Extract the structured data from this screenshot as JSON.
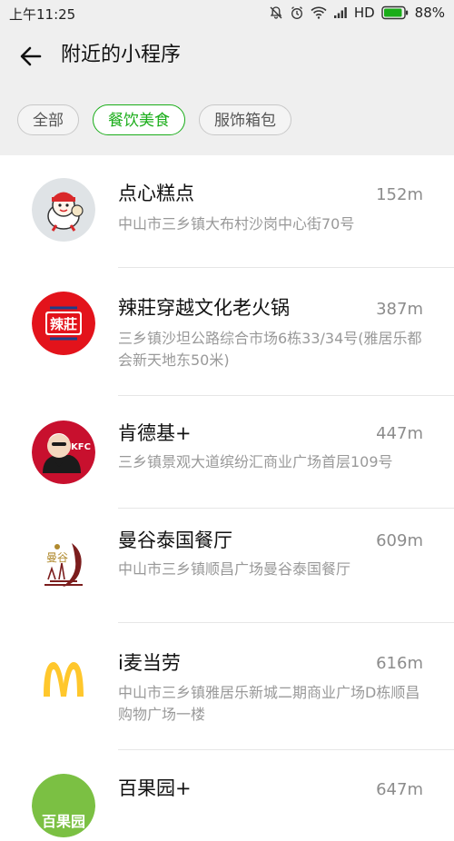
{
  "status_bar": {
    "time": "上午11:25",
    "network": "HD",
    "battery": "88%",
    "icons": [
      "mute-icon",
      "alarm-icon",
      "wifi-icon",
      "signal-icon",
      "battery-icon"
    ]
  },
  "header": {
    "title": "附近的小程序",
    "back_icon": "back-arrow-icon"
  },
  "tabs": [
    {
      "label": "全部",
      "active": false
    },
    {
      "label": "餐饮美食",
      "active": true
    },
    {
      "label": "服饰箱包",
      "active": false
    }
  ],
  "colors": {
    "accent_green": "#1aad19",
    "header_bg": "#efefef",
    "secondary_text": "#999999"
  },
  "items": [
    {
      "name": "点心糕点",
      "distance": "152m",
      "address": "中山市三乡镇大布村沙岗中心街70号",
      "logo_icon": "chef-mascot-icon"
    },
    {
      "name": "辣莊穿越文化老火锅",
      "distance": "387m",
      "address": "三乡镇沙坦公路综合市场6栋33/34号(雅居乐都会新天地东50米)",
      "logo_text": "辣莊",
      "logo_icon": "lazhuang-logo"
    },
    {
      "name": "肯德基+",
      "distance": "447m",
      "address": "三乡镇景观大道缤纷汇商业广场首层109号",
      "logo_text": "KFC",
      "logo_icon": "kfc-logo"
    },
    {
      "name": "曼谷泰国餐厅",
      "distance": "609m",
      "address": "中山市三乡镇顺昌广场曼谷泰国餐厅",
      "logo_text": "曼谷",
      "logo_icon": "bangkok-logo"
    },
    {
      "name": "i麦当劳",
      "distance": "616m",
      "address": "中山市三乡镇雅居乐新城二期商业广场D栋顺昌购物广场一楼",
      "logo_icon": "mcdonalds-logo"
    },
    {
      "name": "百果园+",
      "distance": "647m",
      "address": "",
      "logo_text": "百果园",
      "logo_icon": "baiguoyuan-logo"
    }
  ]
}
